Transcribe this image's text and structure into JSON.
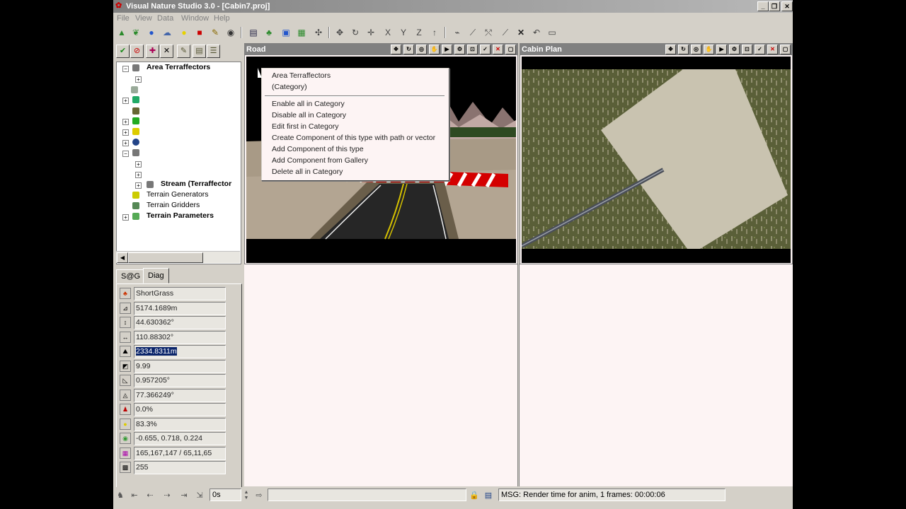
{
  "window": {
    "title": "Visual Nature Studio 3.0  - [Cabin7.proj]"
  },
  "menubar": {
    "items": [
      "File",
      "View",
      "Data",
      "Window",
      "Help"
    ]
  },
  "tree": {
    "items": [
      {
        "label": "Area Terraffectors",
        "bold": true
      },
      {
        "label": "Stream (Terraffector",
        "bold": true
      },
      {
        "label": "Terrain Generators",
        "bold": false
      },
      {
        "label": "Terrain Gridders",
        "bold": false
      },
      {
        "label": "Terrain Parameters",
        "bold": true
      }
    ]
  },
  "context_menu": {
    "header": [
      "Area Terraffectors",
      "(Category)"
    ],
    "items": [
      "Enable all in Category",
      "Disable all in Category",
      "Edit first in Category",
      "Create Component of this type with path or vector",
      "Add Component of this type",
      "Add Component from Gallery",
      "Delete all in Category"
    ]
  },
  "tabs": [
    "S@G",
    "Diag"
  ],
  "diag": {
    "values": [
      "ShortGrass",
      "5174.1689m",
      "44.630362°",
      "110.88302°",
      "2334.8311m",
      "9.99",
      "0.957205°",
      "77.366249°",
      "0.0%",
      "83.3%",
      "-0.655, 0.718, 0.224",
      "165,167,147 / 65,11,65",
      "255"
    ]
  },
  "viewports": {
    "top_left_title": "Road",
    "top_right_title": "Cabin Plan"
  },
  "statusbar": {
    "time_value": "0s",
    "message": "MSG: Render time for anim, 1 frames:  00:00:06"
  },
  "colors": {
    "title_bar": "#808080",
    "face": "#d4d0c8",
    "viewport_bg": "#fdf4f4",
    "selection": "#0a246a"
  }
}
